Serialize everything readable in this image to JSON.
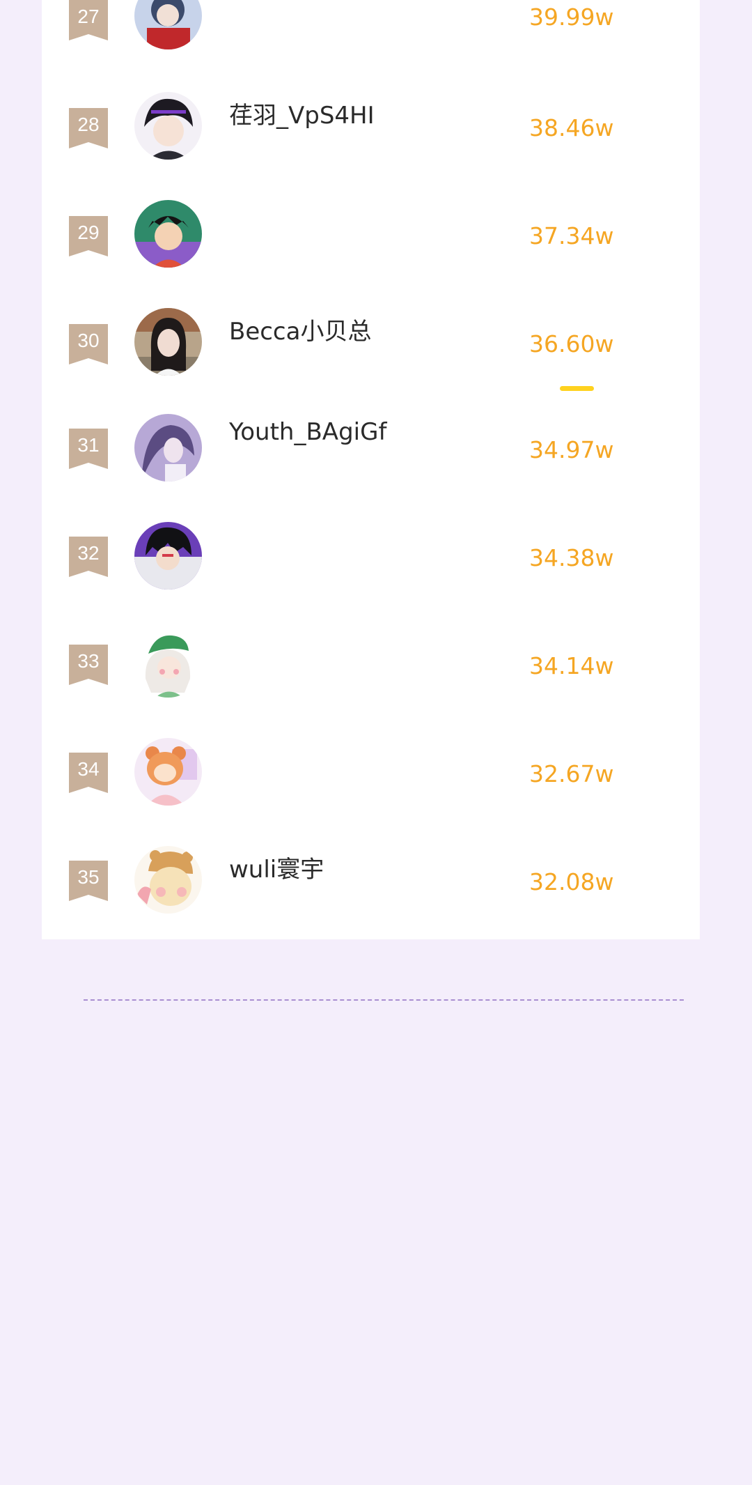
{
  "leaderboard": {
    "rows": [
      {
        "rank": "27",
        "name": "",
        "score": "39.99w",
        "avatar_icon": "anime-avatar-icon"
      },
      {
        "rank": "28",
        "name": "荏羽_VpS4HI",
        "score": "38.46w",
        "avatar_icon": "anime-avatar-icon"
      },
      {
        "rank": "29",
        "name": "",
        "score": "37.34w",
        "avatar_icon": "anime-avatar-icon"
      },
      {
        "rank": "30",
        "name": "Becca小贝总",
        "score": "36.60w",
        "avatar_icon": "photo-avatar-icon"
      },
      {
        "rank": "31",
        "name": "Youth_BAgiGf",
        "score": "34.97w",
        "avatar_icon": "anime-avatar-icon"
      },
      {
        "rank": "32",
        "name": "",
        "score": "34.38w",
        "avatar_icon": "anime-avatar-icon"
      },
      {
        "rank": "33",
        "name": "",
        "score": "34.14w",
        "avatar_icon": "anime-avatar-icon"
      },
      {
        "rank": "34",
        "name": "",
        "score": "32.67w",
        "avatar_icon": "anime-avatar-icon"
      },
      {
        "rank": "35",
        "name": "wuli寰宇",
        "score": "32.08w",
        "avatar_icon": "anime-avatar-icon"
      }
    ]
  },
  "colors": {
    "page_background": "#f4eefb",
    "card_background": "#ffffff",
    "rank_badge": "#c8b09a",
    "score_text": "#f5a623",
    "scroll_marker": "#ffd21f",
    "divider": "#a98ed0"
  }
}
